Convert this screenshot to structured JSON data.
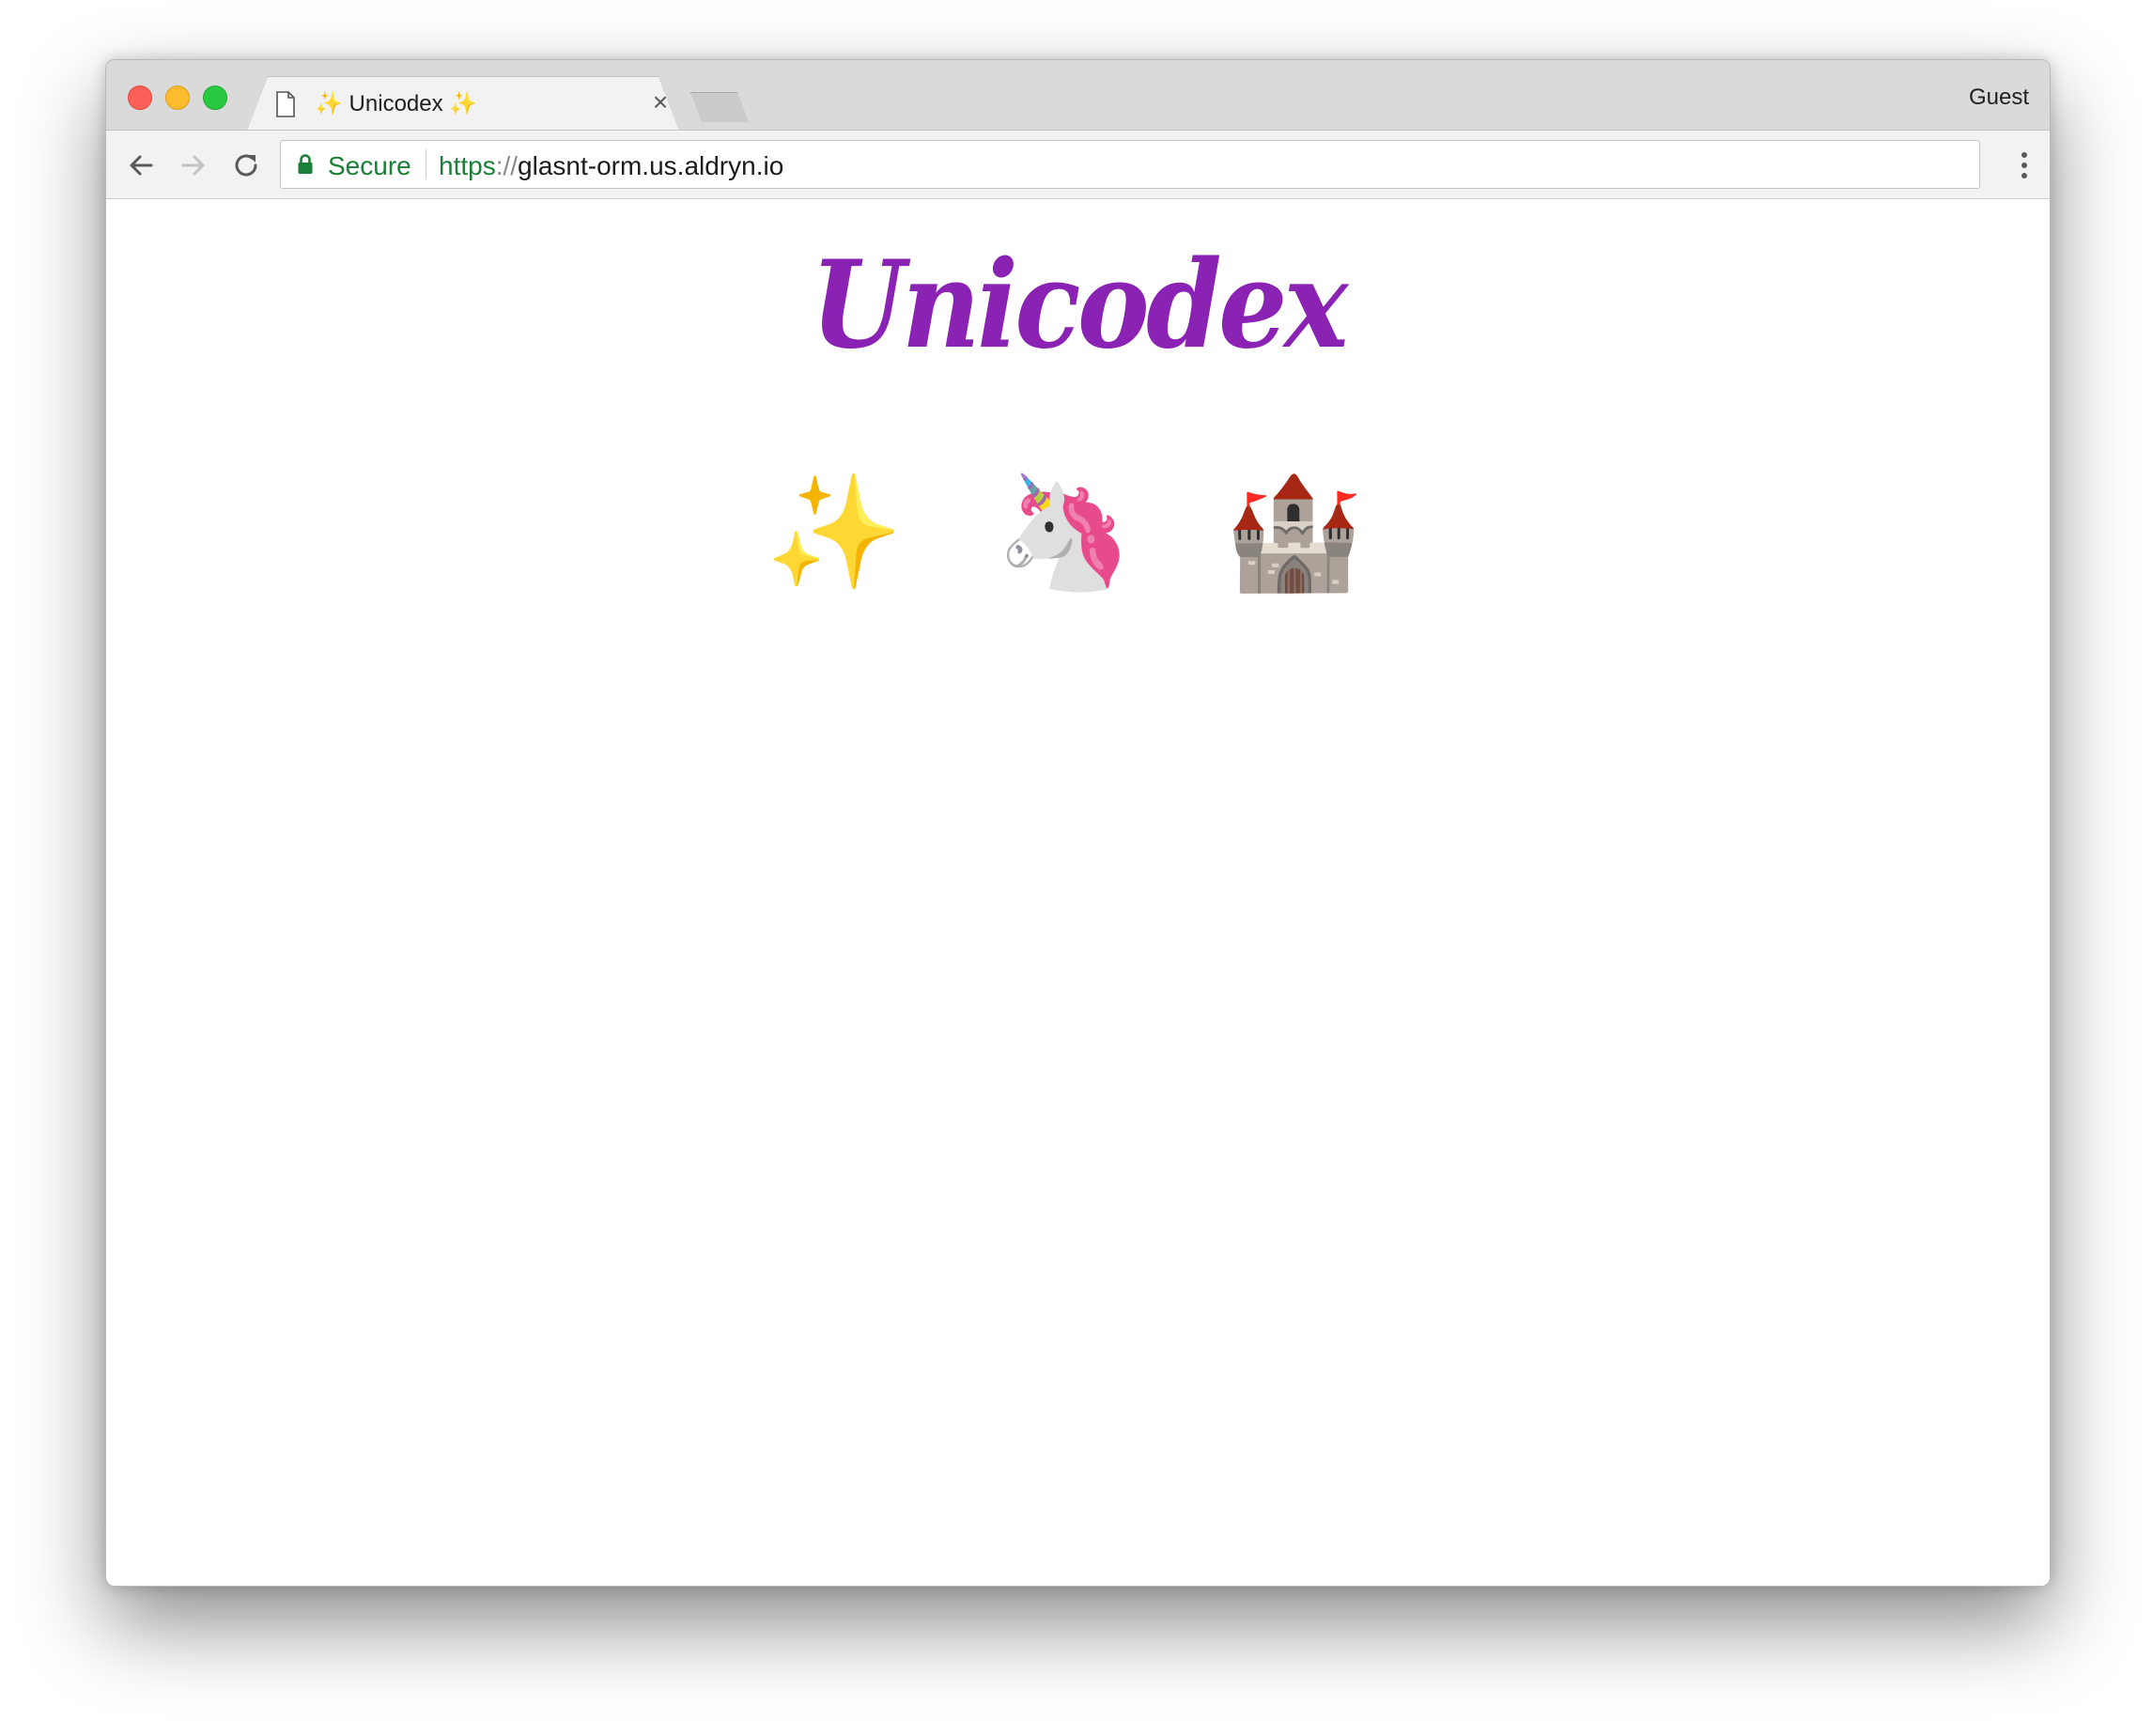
{
  "browser": {
    "tab": {
      "title": "✨ Unicodex ✨",
      "close_glyph": "×"
    },
    "profile": "Guest",
    "address_bar": {
      "security_label": "Secure",
      "url_scheme": "https",
      "url_separator": "://",
      "url_host": "glasnt-orm.us.aldryn.io"
    },
    "colors": {
      "secure_green": "#1a7f37",
      "close_red": "#fc5f57",
      "minimize_yellow": "#fdbc2e",
      "zoom_green": "#28c840"
    }
  },
  "page": {
    "logo": "Unicodex",
    "logo_color": "#8a22b3",
    "emojis": [
      "✨",
      "🦄",
      "🏰"
    ]
  }
}
